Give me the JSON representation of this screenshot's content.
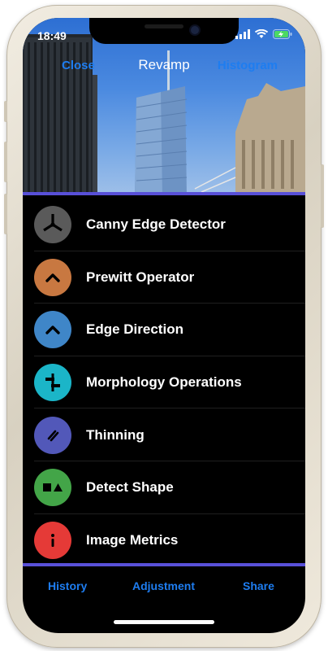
{
  "status_bar": {
    "time": "18:49"
  },
  "navbar": {
    "left": "Close",
    "title": "Revamp",
    "right": "Histogram"
  },
  "colors": {
    "accent": "#1e7df0",
    "divider": "#5850d8"
  },
  "tools": [
    {
      "label": "Canny Edge Detector",
      "icon": "tri-spoke-icon",
      "color": "#5a5a5a"
    },
    {
      "label": "Prewitt Operator",
      "icon": "chevron-up-icon",
      "color": "#c87841"
    },
    {
      "label": "Edge Direction",
      "icon": "chevron-up-icon",
      "color": "#3f86c8"
    },
    {
      "label": "Morphology Operations",
      "icon": "morphology-icon",
      "color": "#1bb5c8"
    },
    {
      "label": "Thinning",
      "icon": "double-slash-icon",
      "color": "#5258b9"
    },
    {
      "label": "Detect Shape",
      "icon": "square-triangle-icon",
      "color": "#43a548"
    },
    {
      "label": "Image Metrics",
      "icon": "info-icon",
      "color": "#e53a37"
    }
  ],
  "tabbar": {
    "history": "History",
    "adjustment": "Adjustment",
    "share": "Share"
  }
}
